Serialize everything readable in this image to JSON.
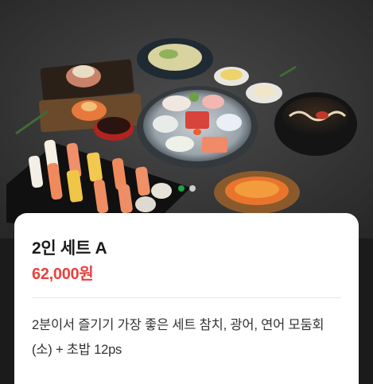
{
  "hero": {
    "image_alt": "sushi and sashimi set",
    "carousel": {
      "count": 2,
      "active_index": 0
    },
    "colors": {
      "active_dot": "#1aa34a",
      "inactive_dot": "#ffffff"
    }
  },
  "product": {
    "name": "2인 세트 A",
    "price": "62,000원",
    "description": "2분이서 즐기기 가장 좋은 세트 참치, 광어, 연어 모둠회 (소) + 초밥 12ps"
  },
  "colors": {
    "price": "#e8423f",
    "title": "#1a1a1a"
  }
}
